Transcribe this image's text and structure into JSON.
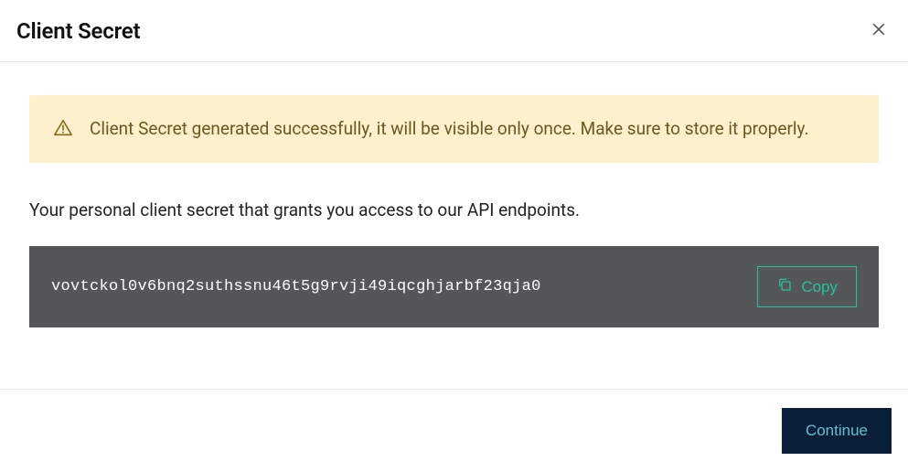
{
  "header": {
    "title": "Client Secret"
  },
  "alert": {
    "message": "Client Secret generated successfully, it will be visible only once. Make sure to store it properly."
  },
  "body": {
    "description": "Your personal client secret that grants you access to our API endpoints.",
    "secret_value": "vovtckol0v6bnq2suthssnu46t5g9rvji49iqcghjarbf23qja0",
    "copy_label": "Copy"
  },
  "footer": {
    "continue_label": "Continue"
  }
}
